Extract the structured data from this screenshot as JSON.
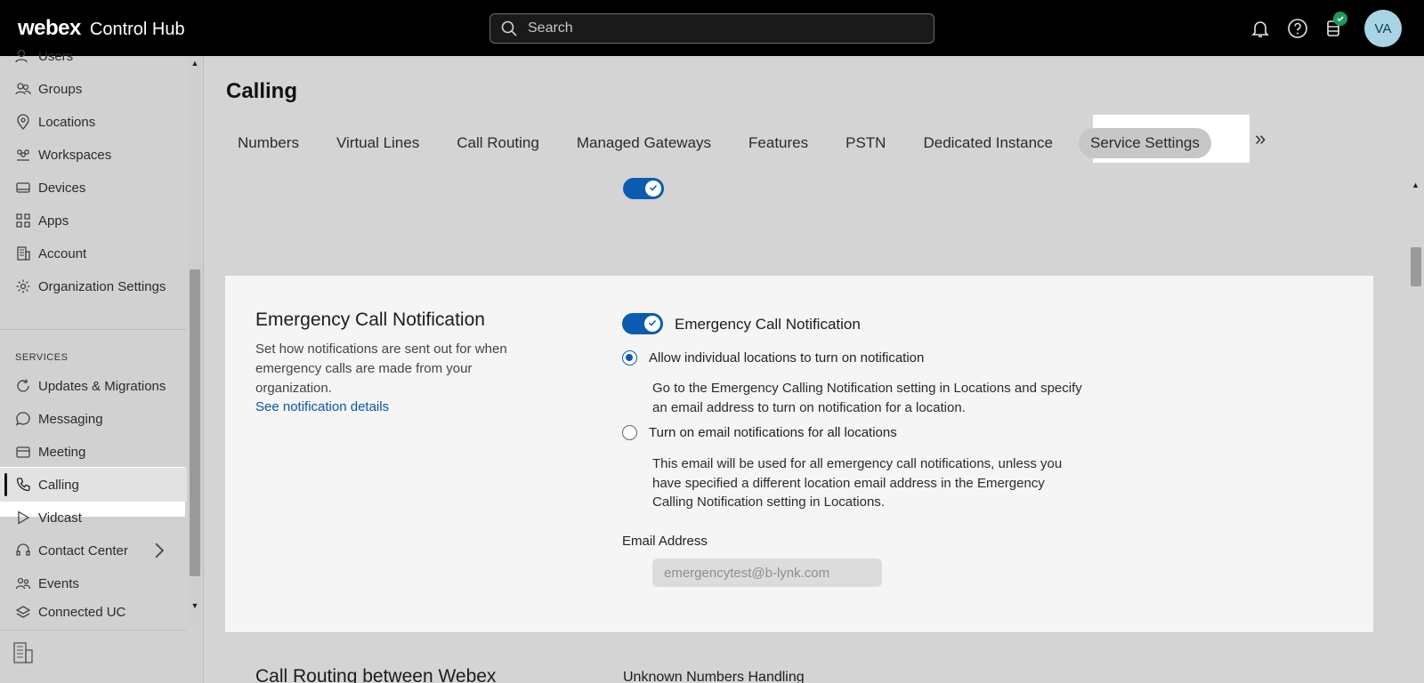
{
  "header": {
    "brand": "webex",
    "product": "Control Hub",
    "search_placeholder": "Search",
    "avatar_initials": "VA",
    "icons": [
      "bell-icon",
      "help-icon",
      "database-icon"
    ]
  },
  "sidebar": {
    "items": [
      {
        "label": "Users",
        "icon": "user-icon"
      },
      {
        "label": "Groups",
        "icon": "group-icon"
      },
      {
        "label": "Locations",
        "icon": "location-icon"
      },
      {
        "label": "Workspaces",
        "icon": "workspace-icon"
      },
      {
        "label": "Devices",
        "icon": "device-icon"
      },
      {
        "label": "Apps",
        "icon": "apps-icon"
      },
      {
        "label": "Account",
        "icon": "account-icon"
      },
      {
        "label": "Organization Settings",
        "icon": "gear-icon"
      }
    ],
    "section_label": "SERVICES",
    "services": [
      {
        "label": "Updates & Migrations",
        "icon": "refresh-icon"
      },
      {
        "label": "Messaging",
        "icon": "chat-icon"
      },
      {
        "label": "Meeting",
        "icon": "meeting-icon"
      },
      {
        "label": "Calling",
        "icon": "phone-icon",
        "active": true
      },
      {
        "label": "Vidcast",
        "icon": "play-icon"
      },
      {
        "label": "Contact Center",
        "icon": "headset-icon",
        "has_submenu": true
      },
      {
        "label": "Events",
        "icon": "events-icon"
      },
      {
        "label": "Connected UC",
        "icon": "connected-icon"
      }
    ]
  },
  "main": {
    "title": "Calling",
    "tabs": [
      "Numbers",
      "Virtual Lines",
      "Call Routing",
      "Managed Gateways",
      "Features",
      "PSTN",
      "Dedicated Instance",
      "Service Settings"
    ],
    "active_tab": "Service Settings",
    "emergency": {
      "title": "Emergency Call Notification",
      "description": "Set how notifications are sent out for when emergency calls are made from your organization.",
      "link": "See notification details",
      "toggle_label": "Emergency Call Notification",
      "toggle_on": true,
      "option1": "Allow individual locations to turn on notification",
      "option1_help": "Go to the Emergency Calling Notification setting in Locations and specify an email address to turn on notification for a location.",
      "option2": "Turn on email notifications for all locations",
      "option2_help": "This email will be used for all emergency call notifications, unless you have specified a different location email address in the Emergency Calling Notification setting in Locations.",
      "email_label": "Email Address",
      "email_value": "emergencytest@b-lynk.com",
      "selected_option": 1
    },
    "next_section_title": "Call Routing between Webex",
    "next_section_label": "Unknown Numbers Handling"
  }
}
